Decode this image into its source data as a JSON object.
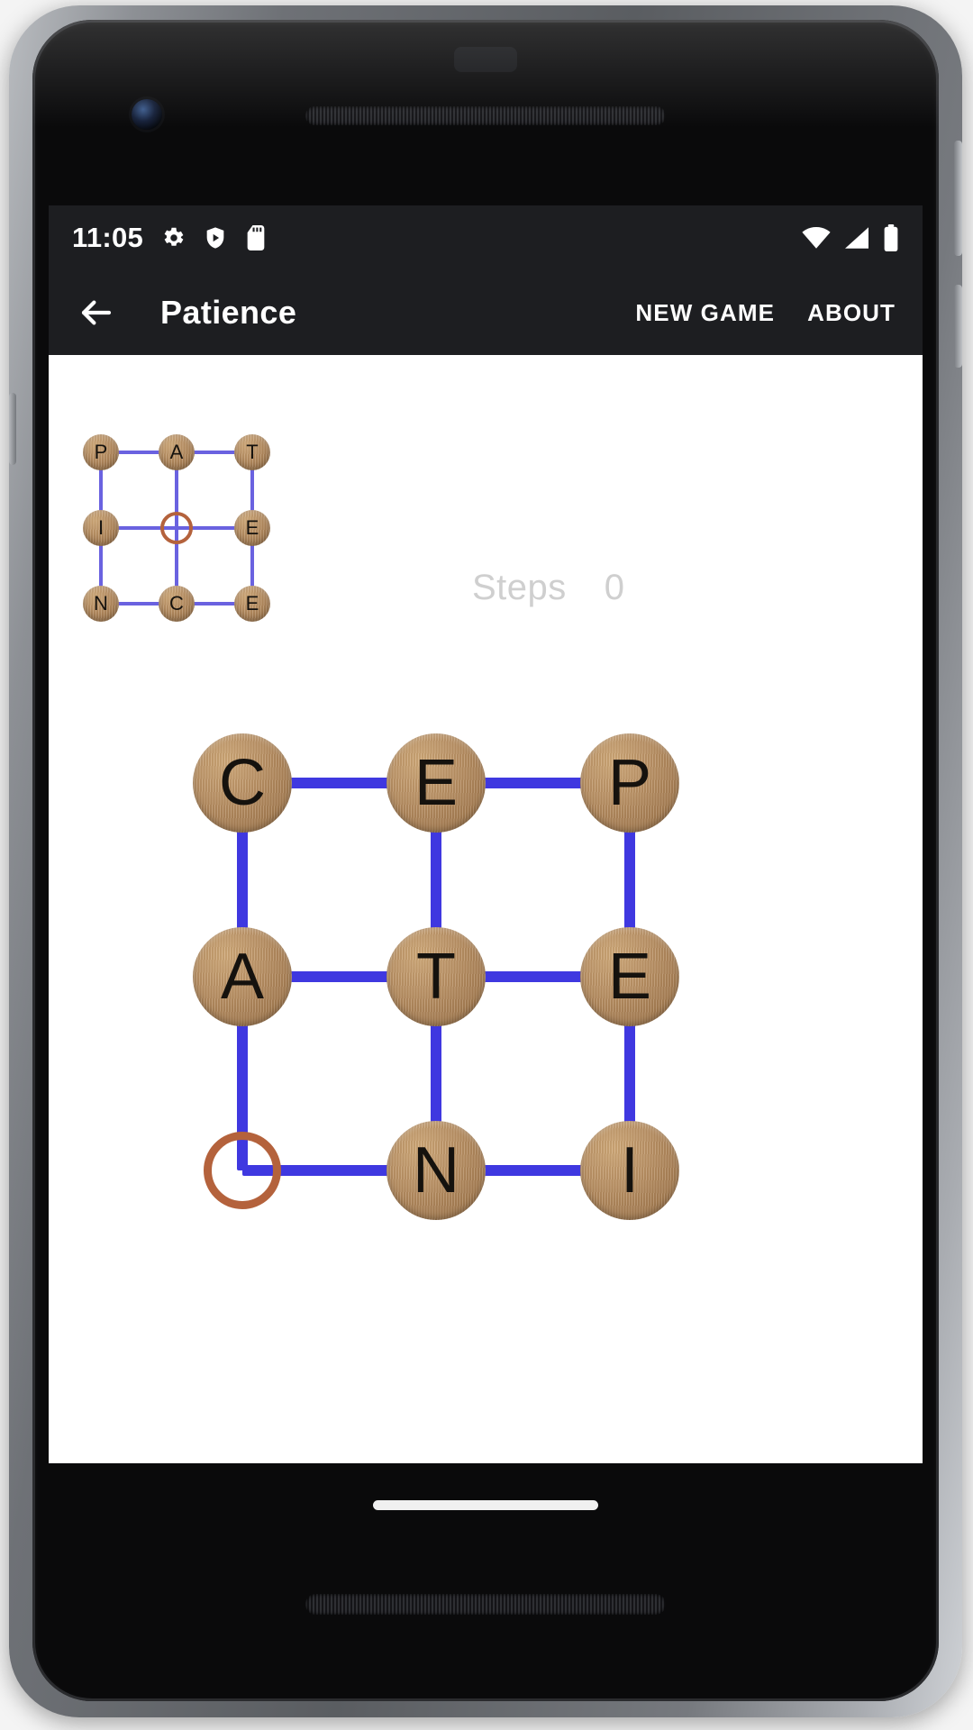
{
  "statusbar": {
    "time": "11:05",
    "left_icons": [
      "gear-icon",
      "shield-play-icon",
      "sd-card-icon"
    ],
    "right_icons": [
      "wifi-icon",
      "cell-signal-icon",
      "battery-icon"
    ]
  },
  "appbar": {
    "back_icon": "back-arrow-icon",
    "title": "Patience",
    "actions": [
      {
        "label": "NEW GAME",
        "name": "new-game-button"
      },
      {
        "label": "ABOUT",
        "name": "about-button"
      }
    ]
  },
  "steps": {
    "label": "Steps",
    "value": "0"
  },
  "colors": {
    "link": "#3f38e0",
    "mini_link": "#6a62e0",
    "hole_ring": "#b4623c",
    "tile_wood": "#bb9265",
    "appbar_bg": "#1d1e21",
    "steps_text": "#cfcfcf"
  },
  "target_board": {
    "name": "target-preview-grid",
    "rows": 3,
    "cols": 3,
    "word": "PATIENCE",
    "cells": [
      [
        "P",
        "A",
        "T"
      ],
      [
        "I",
        "",
        "E"
      ],
      [
        "N",
        "C",
        "E"
      ]
    ],
    "empty_cell": {
      "row": 1,
      "col": 1
    }
  },
  "play_board": {
    "name": "play-grid",
    "rows": 3,
    "cols": 3,
    "cells": [
      [
        "C",
        "E",
        "P"
      ],
      [
        "A",
        "T",
        "E"
      ],
      [
        "",
        "N",
        "I"
      ]
    ],
    "empty_cell": {
      "row": 2,
      "col": 0
    }
  }
}
